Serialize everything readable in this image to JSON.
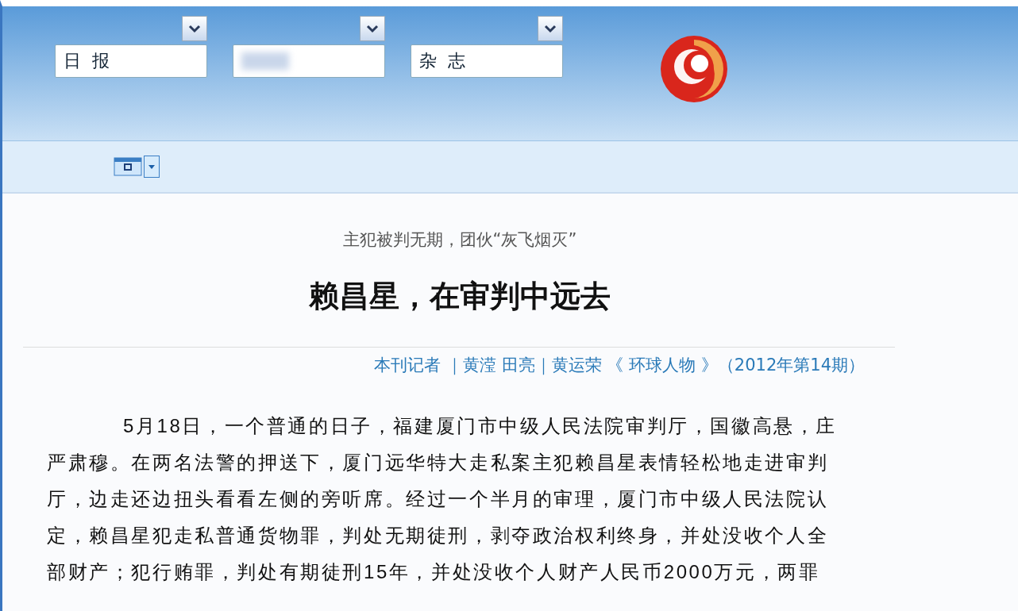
{
  "header": {
    "selectors": [
      {
        "kind": "text",
        "value": "日  报"
      },
      {
        "kind": "blurred"
      },
      {
        "kind": "text",
        "value": "杂  志"
      }
    ]
  },
  "article": {
    "kicker": "主犯被判无期，团伙“灰飞烟灭”",
    "title": "赖昌星，在审判中远去",
    "byline": "本刊记者 ｜黄滢 田亮｜黄运荣 《 环球人物 》（2012年第14期）",
    "paragraph": "5月18日，一个普通的日子，福建厦门市中级人民法院审判厅，国徽高悬，庄严肃穆。在两名法警的押送下，厦门远华特大走私案主犯赖昌星表情轻松地走进审判厅，边走还边扭头看看左侧的旁听席。经过一个半月的审理，厦门市中级人民法院认定，赖昌星犯走私普通货物罪，判处无期徒刑，剥夺政治权利终身，并处没收个人全部财产；犯行贿罪，判处有期徒刑15年，并处没收个人财产人民币2000万元，两罪"
  }
}
